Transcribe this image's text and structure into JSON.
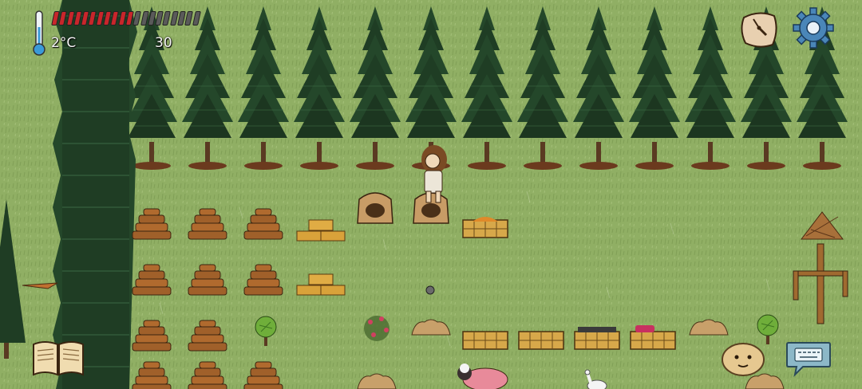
{
  "hud": {
    "temperature": "2°C",
    "food_pips_total": 20,
    "food_pips_filled": 11,
    "yum_value": "30"
  },
  "buttons": {
    "clock_icon": "clock-icon",
    "settings_icon": "gear-icon",
    "recipe_book_icon": "book-icon",
    "emote_icon": "potato-face-icon",
    "keyboard_icon": "keyboard-icon"
  },
  "colors": {
    "grass": "#8aa85e",
    "food_full": "#c8262b",
    "food_empty": "#5a5a5a",
    "pine_dark": "#1f3d24",
    "settings_blue": "#4a86b8"
  }
}
